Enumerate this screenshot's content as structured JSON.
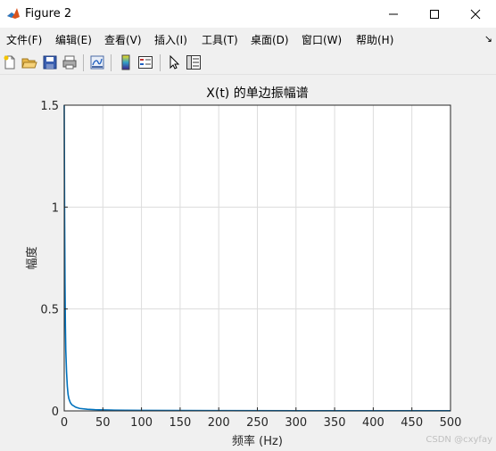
{
  "window": {
    "title": "Figure 2",
    "minimize_glyph": "—",
    "maximize_glyph": "☐",
    "close_glyph": "✕"
  },
  "menu": {
    "items": [
      "文件(F)",
      "编辑(E)",
      "查看(V)",
      "插入(I)",
      "工具(T)",
      "桌面(D)",
      "窗口(W)",
      "帮助(H)"
    ],
    "overflow_glyph": "↘"
  },
  "toolbar": {
    "buttons": [
      "new-figure-icon",
      "open-file-icon",
      "save-icon",
      "print-icon",
      "link-plot-icon",
      "colorbar-icon",
      "legend-icon",
      "pointer-icon",
      "property-inspector-icon"
    ]
  },
  "chart_data": {
    "type": "line",
    "title": "X(t) 的单边振幅谱",
    "xlabel": "频率 (Hz)",
    "ylabel": "幅度",
    "xlim": [
      0,
      500
    ],
    "ylim": [
      0,
      1.5
    ],
    "xticks": [
      "0",
      "50",
      "100",
      "150",
      "200",
      "250",
      "300",
      "350",
      "400",
      "450",
      "500"
    ],
    "yticks": [
      "0",
      "0.5",
      "1",
      "1.5"
    ],
    "grid": true,
    "series": [
      {
        "color": "#0072bd",
        "x": [
          0,
          0.5,
          1,
          1.5,
          2,
          3,
          4,
          5,
          6,
          8,
          10,
          15,
          20,
          30,
          40,
          60,
          80,
          100,
          150,
          200,
          300,
          400,
          500
        ],
        "y": [
          1.5,
          0.95,
          0.62,
          0.42,
          0.3,
          0.19,
          0.12,
          0.08,
          0.06,
          0.04,
          0.03,
          0.018,
          0.012,
          0.008,
          0.006,
          0.004,
          0.003,
          0.0025,
          0.002,
          0.0015,
          0.001,
          0.0008,
          0.0006
        ]
      }
    ]
  },
  "watermark": "CSDN @cxyfay"
}
